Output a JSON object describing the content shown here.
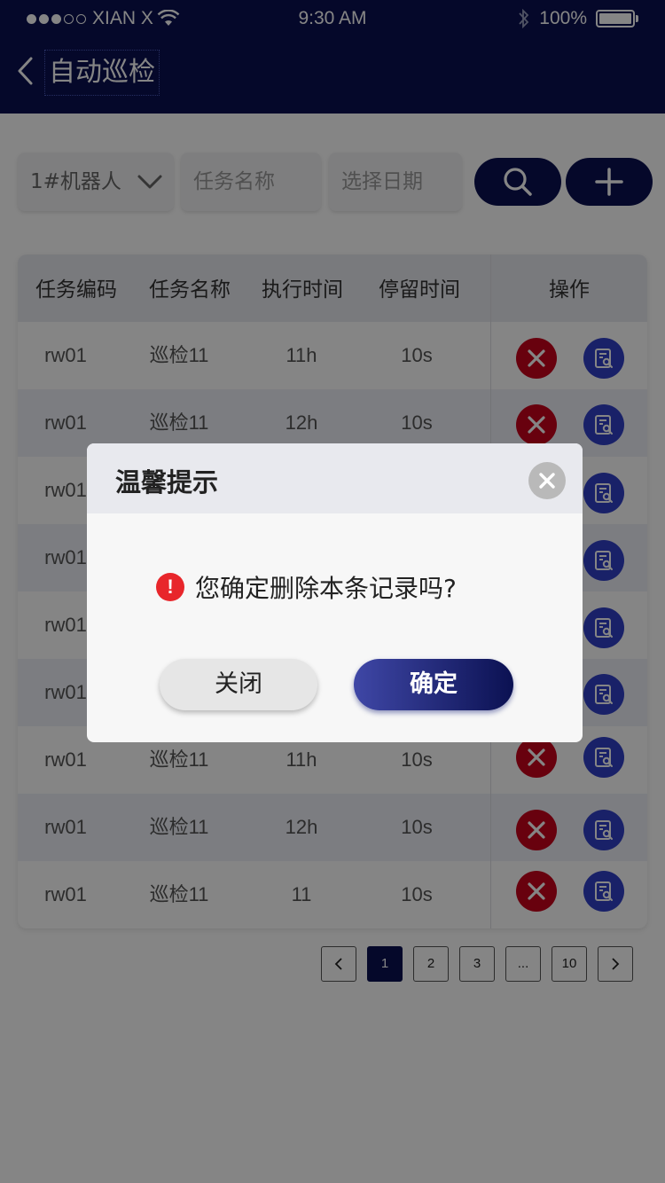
{
  "status_bar": {
    "carrier": "XIAN X",
    "time": "9:30 AM",
    "battery": "100%"
  },
  "header": {
    "title": "自动巡检"
  },
  "filters": {
    "robot_value": "1#机器人",
    "task_name_placeholder": "任务名称",
    "date_placeholder": "选择日期"
  },
  "table": {
    "headers": [
      "任务编码",
      "任务名称",
      "执行时间",
      "停留时间",
      "操作"
    ],
    "rows": [
      {
        "code": "rw01",
        "name": "巡检11",
        "exec_time": "11h",
        "stay_time": "10s"
      },
      {
        "code": "rw01",
        "name": "巡检11",
        "exec_time": "12h",
        "stay_time": "10s"
      },
      {
        "code": "rw01",
        "name": "",
        "exec_time": "",
        "stay_time": ""
      },
      {
        "code": "rw01",
        "name": "",
        "exec_time": "",
        "stay_time": ""
      },
      {
        "code": "rw01",
        "name": "",
        "exec_time": "",
        "stay_time": ""
      },
      {
        "code": "rw01",
        "name": "",
        "exec_time": "",
        "stay_time": ""
      },
      {
        "code": "rw01",
        "name": "巡检11",
        "exec_time": "11h",
        "stay_time": "10s"
      },
      {
        "code": "rw01",
        "name": "巡检11",
        "exec_time": "12h",
        "stay_time": "10s"
      },
      {
        "code": "rw01",
        "name": "巡检11",
        "exec_time": "11",
        "stay_time": "10s"
      }
    ]
  },
  "pagination": {
    "pages": [
      "1",
      "2",
      "3",
      "...",
      "10"
    ],
    "current": "1"
  },
  "dialog": {
    "title": "温馨提示",
    "message": "您确定删除本条记录吗?",
    "cancel_label": "关闭",
    "confirm_label": "确定"
  },
  "colors": {
    "brand_navy": "#0b1152",
    "delete_red": "#c7021b",
    "view_blue": "#3140c8"
  }
}
